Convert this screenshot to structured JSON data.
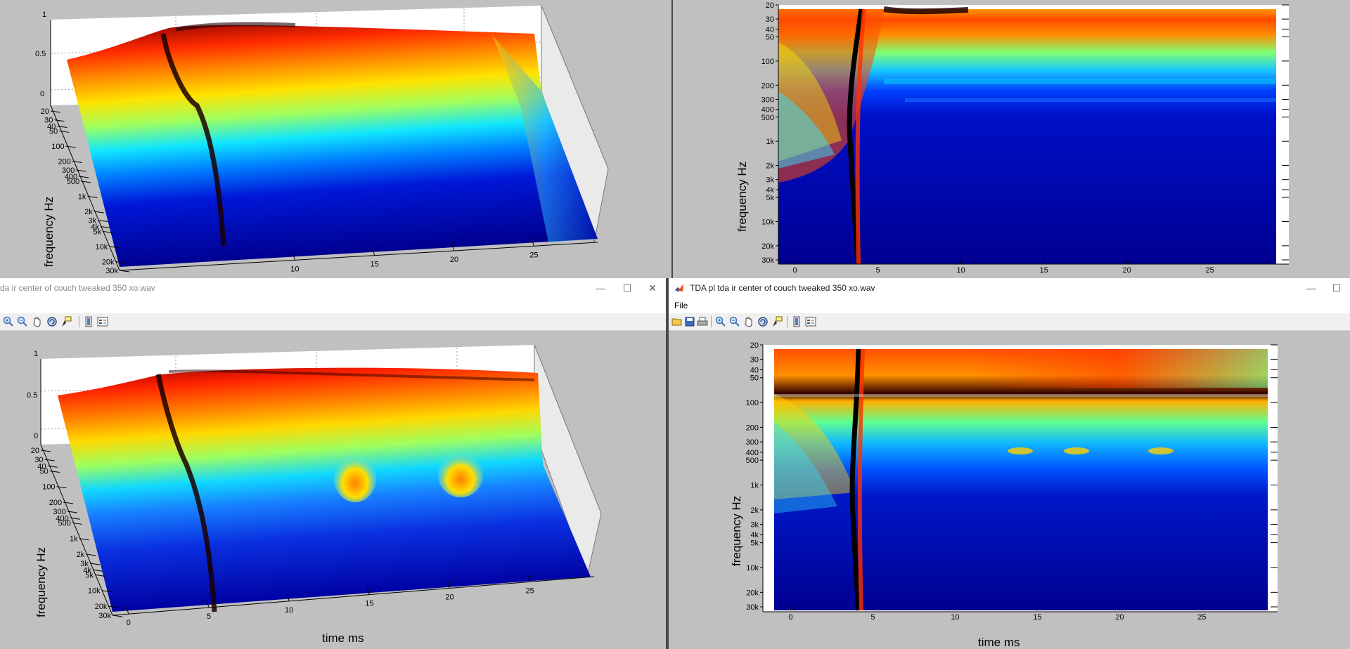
{
  "windows": {
    "bottom_left": {
      "title": "da ir center of couch tweaked 350 xo.wav"
    },
    "bottom_right": {
      "title": "TDA pl tda ir center of couch tweaked 350 xo.wav",
      "menu": {
        "file": "File"
      }
    }
  },
  "window_buttons": {
    "minimize": "—",
    "maximize": "☐",
    "close": "✕"
  },
  "toolbar_icons": [
    "open-icon",
    "save-icon",
    "print-icon",
    "zoom-in-icon",
    "zoom-out-icon",
    "pan-icon",
    "rotate-icon",
    "data-cursor-icon",
    "colorbar-icon",
    "legend-icon"
  ],
  "colormap": {
    "name": "jet",
    "low": "#00008f",
    "mid": "#7fff7f",
    "high": "#800000"
  },
  "chart_data": [
    {
      "id": "top-left-3d",
      "type": "surface",
      "zlabel": "",
      "ylabel": "frequency   Hz",
      "xlabel": "",
      "z_ticks": [
        "1",
        "0.5",
        "0"
      ],
      "freq_ticks": [
        "20",
        "30",
        "40",
        "50",
        "100",
        "200",
        "300",
        "400",
        "500",
        "1k",
        "2k",
        "3k",
        "4k",
        "5k",
        "10k",
        "20k",
        "30k"
      ],
      "time_ticks": [
        "10",
        "15",
        "20",
        "25"
      ],
      "zlim": [
        0,
        1
      ]
    },
    {
      "id": "top-right-heatmap",
      "type": "heatmap",
      "ylabel": "frequency   Hz",
      "xlabel": "",
      "freq_ticks": [
        "20",
        "30",
        "40",
        "50",
        "100",
        "200",
        "300",
        "400",
        "500",
        "1k",
        "2k",
        "3k",
        "4k",
        "5k",
        "10k",
        "20k",
        "30k"
      ],
      "time_ticks": [
        "0",
        "5",
        "10",
        "15",
        "20",
        "25"
      ],
      "xlim": [
        -1,
        29
      ],
      "ylim": [
        20,
        30000
      ],
      "yscale": "log"
    },
    {
      "id": "bottom-left-3d",
      "type": "surface",
      "zlabel": "",
      "ylabel": "frequency   Hz",
      "xlabel": "time   ms",
      "z_ticks": [
        "1",
        "0.5",
        "0"
      ],
      "freq_ticks": [
        "20",
        "30",
        "40",
        "50",
        "100",
        "200",
        "300",
        "400",
        "500",
        "1k",
        "2k",
        "3k",
        "4k",
        "5k",
        "10k",
        "20k",
        "30k"
      ],
      "time_ticks": [
        "0",
        "5",
        "10",
        "15",
        "20",
        "25"
      ],
      "zlim": [
        0,
        1
      ]
    },
    {
      "id": "bottom-right-heatmap",
      "type": "heatmap",
      "ylabel": "frequency   Hz",
      "xlabel": "time   ms",
      "freq_ticks": [
        "20",
        "30",
        "40",
        "50",
        "100",
        "200",
        "300",
        "400",
        "500",
        "1k",
        "2k",
        "3k",
        "4k",
        "5k",
        "10k",
        "20k",
        "30k"
      ],
      "time_ticks": [
        "0",
        "5",
        "10",
        "15",
        "20",
        "25"
      ],
      "xlim": [
        -1,
        29
      ],
      "ylim": [
        20,
        30000
      ],
      "yscale": "log"
    }
  ]
}
